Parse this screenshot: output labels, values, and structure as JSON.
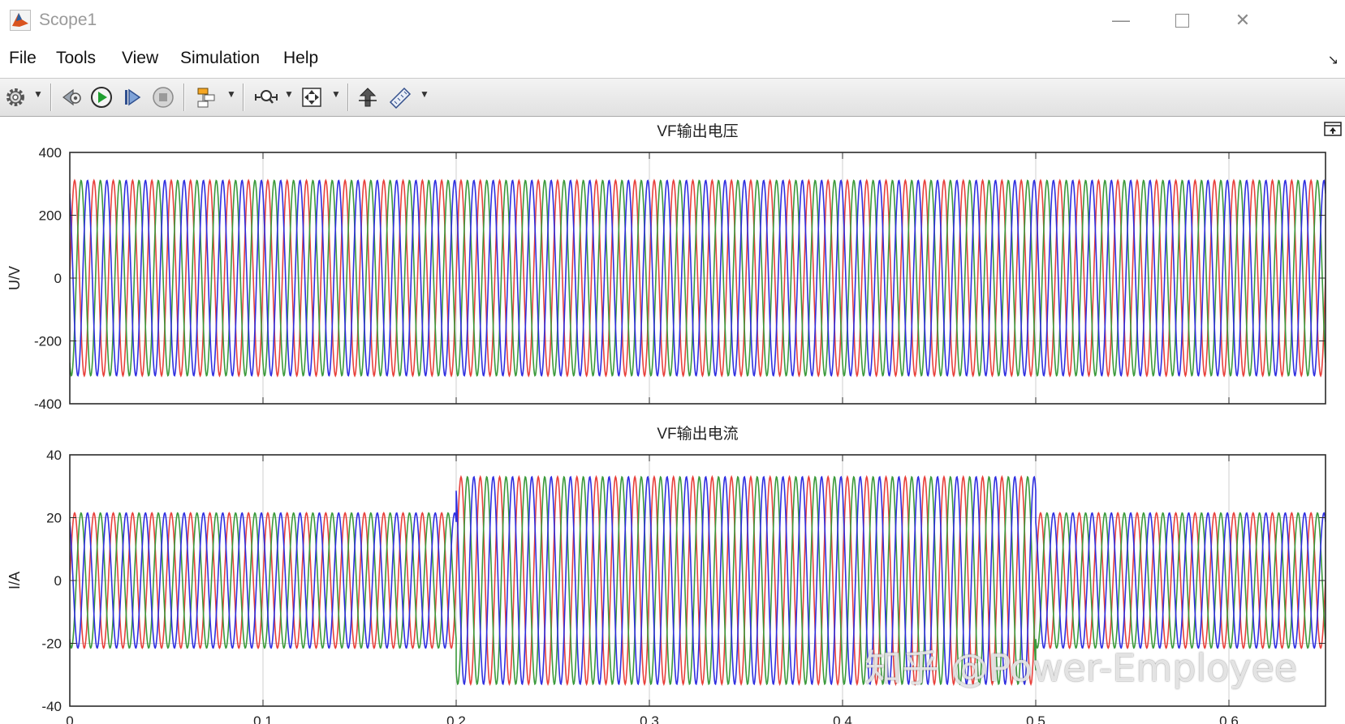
{
  "window": {
    "title": "Scope1",
    "controls": [
      "minimize",
      "maximize",
      "close"
    ]
  },
  "menu": [
    "File",
    "Tools",
    "View",
    "Simulation",
    "Help"
  ],
  "toolbar": {
    "buttons": [
      "gear-icon",
      "step-back-icon",
      "run-icon",
      "step-forward-icon",
      "stop-icon",
      "highlight-icon",
      "zoom-icon",
      "autoscale-icon",
      "cursor-measure-icon",
      "measure-ruler-icon"
    ]
  },
  "colors": {
    "phase_a": "#e8413c",
    "phase_b": "#3b9a3b",
    "phase_c": "#2f2fe0",
    "grid": "#cfcfcf"
  },
  "watermark": "知乎 @Power-Employee",
  "chart_data": [
    {
      "type": "line",
      "title": "VF输出电压",
      "ylabel": "U/V",
      "xlabel": "",
      "xlim": [
        0,
        0.65
      ],
      "ylim": [
        -400,
        400
      ],
      "xticks": [
        0,
        0.1,
        0.2,
        0.3,
        0.4,
        0.5,
        0.6
      ],
      "xtick_labels": [],
      "yticks": [
        400,
        200,
        0,
        -200,
        -400
      ],
      "ytick_labels": [
        "400",
        "200",
        "0",
        "-200",
        "-400"
      ],
      "grid": true,
      "frequency_hz": 100,
      "series": [
        {
          "phase_deg": 0,
          "color": "#e8413c",
          "segments": [
            {
              "x": [
                0,
                0.65
              ],
              "amplitude": 311
            }
          ]
        },
        {
          "phase_deg": -120,
          "color": "#3b9a3b",
          "segments": [
            {
              "x": [
                0,
                0.65
              ],
              "amplitude": 311
            }
          ]
        },
        {
          "phase_deg": 120,
          "color": "#2f2fe0",
          "segments": [
            {
              "x": [
                0,
                0.65
              ],
              "amplitude": 311
            }
          ]
        }
      ]
    },
    {
      "type": "line",
      "title": "VF输出电流",
      "ylabel": "I/A",
      "xlabel": "",
      "xlim": [
        0,
        0.65
      ],
      "ylim": [
        -40,
        40
      ],
      "xticks": [
        0,
        0.1,
        0.2,
        0.3,
        0.4,
        0.5,
        0.6
      ],
      "xtick_labels": [
        "0",
        "0.1",
        "0.2",
        "0.3",
        "0.4",
        "0.5",
        "0.6"
      ],
      "yticks": [
        40,
        20,
        0,
        -20,
        -40
      ],
      "ytick_labels": [
        "40",
        "20",
        "0",
        "-20",
        "-40"
      ],
      "grid": true,
      "frequency_hz": 100,
      "series": [
        {
          "phase_deg": 0,
          "color": "#e8413c",
          "segments": [
            {
              "x": [
                0,
                0.2
              ],
              "amplitude": 21.5
            },
            {
              "x": [
                0.2,
                0.5
              ],
              "amplitude": 33
            },
            {
              "x": [
                0.5,
                0.65
              ],
              "amplitude": 21.5
            }
          ]
        },
        {
          "phase_deg": -120,
          "color": "#3b9a3b",
          "segments": [
            {
              "x": [
                0,
                0.2
              ],
              "amplitude": 21.5
            },
            {
              "x": [
                0.2,
                0.5
              ],
              "amplitude": 33
            },
            {
              "x": [
                0.5,
                0.65
              ],
              "amplitude": 21.5
            }
          ]
        },
        {
          "phase_deg": 120,
          "color": "#2f2fe0",
          "segments": [
            {
              "x": [
                0,
                0.2
              ],
              "amplitude": 21.5
            },
            {
              "x": [
                0.2,
                0.5
              ],
              "amplitude": 33
            },
            {
              "x": [
                0.5,
                0.65
              ],
              "amplitude": 21.5
            }
          ]
        }
      ]
    }
  ]
}
